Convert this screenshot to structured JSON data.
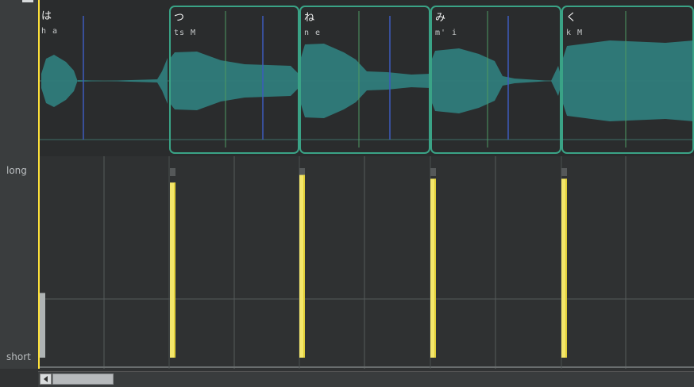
{
  "gutter": {
    "long_label": "long",
    "short_label": "short"
  },
  "notes": [
    {
      "lyric": "は",
      "phonemes": "h a",
      "first": true
    },
    {
      "lyric": "つ",
      "phonemes": "ts M"
    },
    {
      "lyric": "ね",
      "phonemes": "n e"
    },
    {
      "lyric": "み",
      "phonemes": "m' i"
    },
    {
      "lyric": "く",
      "phonemes": "k M"
    }
  ],
  "length_bars": [
    0.34,
    0.92,
    0.96,
    0.94,
    0.94
  ],
  "colors": {
    "accent": "#3aa386",
    "waveform": "#2f7c7b",
    "bar": "#f4e66a",
    "playhead": "#ffe23a",
    "vline_blue": "#3c5bbd",
    "vline_green": "#4f9a62"
  }
}
